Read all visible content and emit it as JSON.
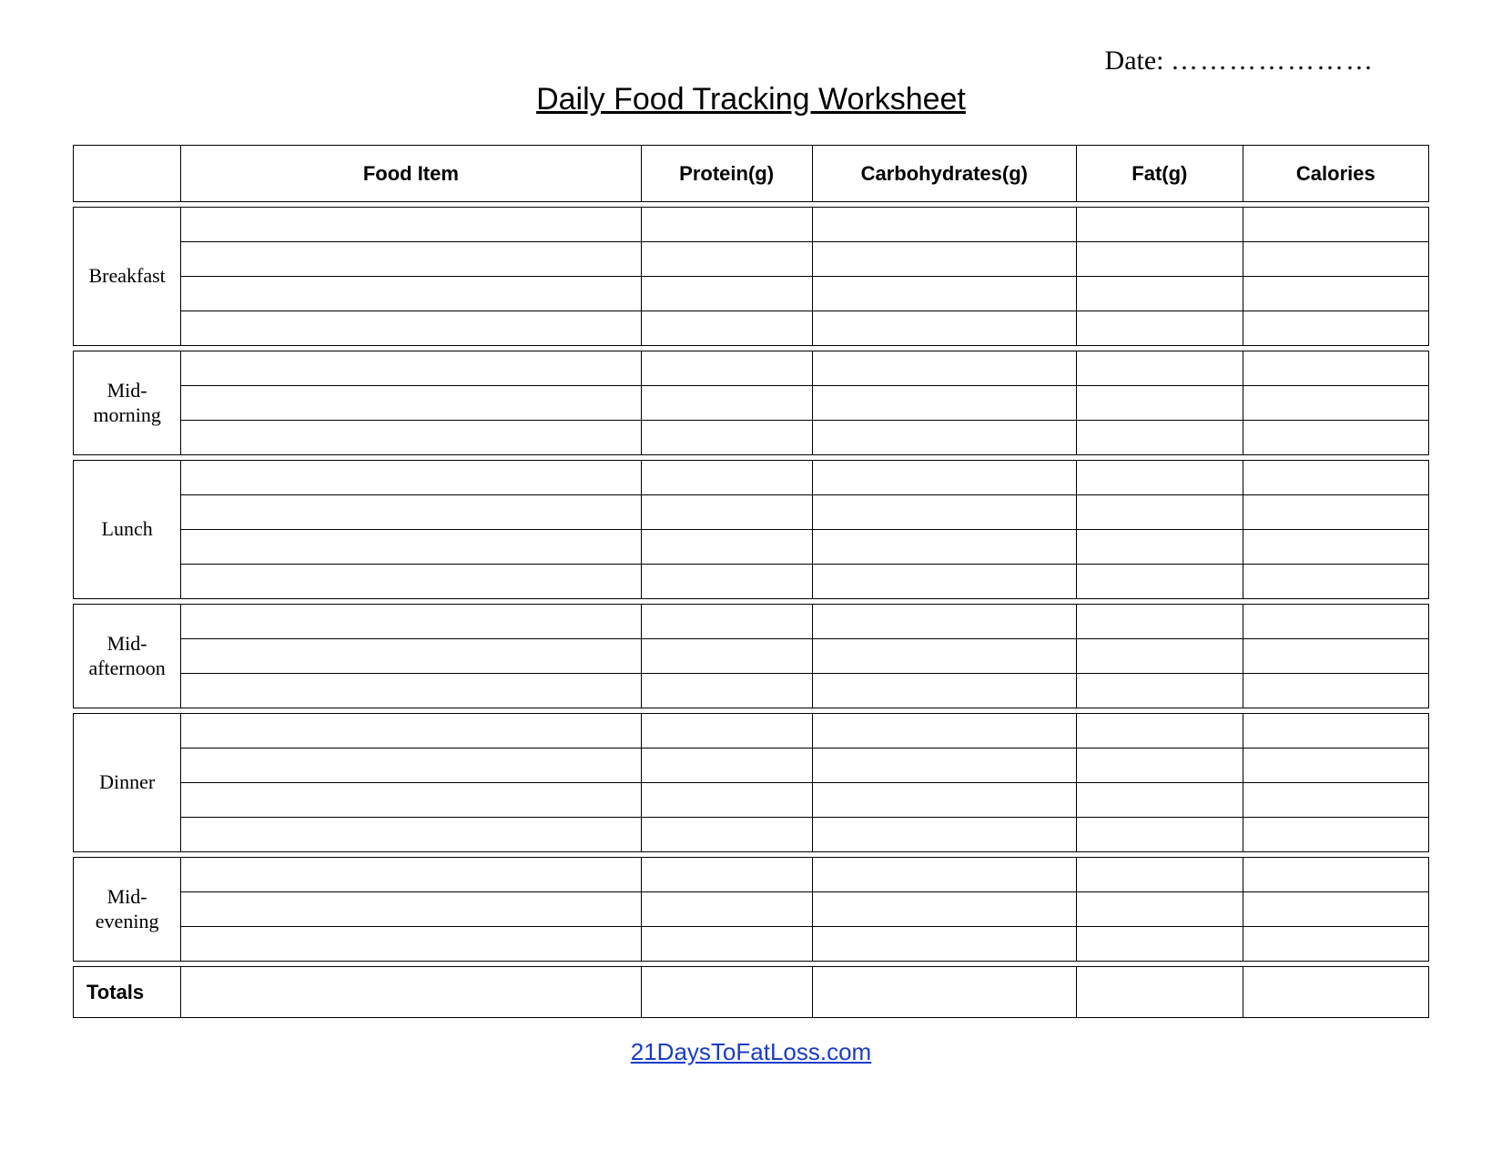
{
  "header": {
    "date_label": "Date:",
    "date_blank": "…………………",
    "title": "Daily Food Tracking Worksheet"
  },
  "columns": {
    "meal": "",
    "food_item": "Food Item",
    "protein": "Protein(g)",
    "carbs": "Carbohydrates(g)",
    "fat": "Fat(g)",
    "calories": "Calories"
  },
  "sections": [
    {
      "label": "Breakfast",
      "rows": 4
    },
    {
      "label": "Mid-morning",
      "rows": 3
    },
    {
      "label": "Lunch",
      "rows": 4
    },
    {
      "label": "Mid-afternoon",
      "rows": 3
    },
    {
      "label": "Dinner",
      "rows": 4
    },
    {
      "label": "Mid-evening",
      "rows": 3
    }
  ],
  "totals_label": "Totals",
  "footer": {
    "link_text": "21DaysToFatLoss.com"
  }
}
